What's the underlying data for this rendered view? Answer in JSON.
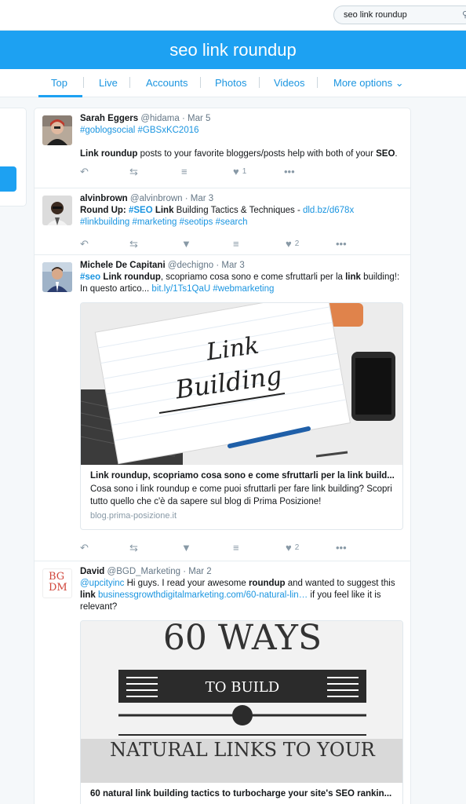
{
  "search": {
    "query": "seo link roundup",
    "icon": "search-icon"
  },
  "header": {
    "title": "seo link roundup"
  },
  "tabs": [
    {
      "label": "Top"
    },
    {
      "label": "Live"
    },
    {
      "label": "Accounts"
    },
    {
      "label": "Photos"
    },
    {
      "label": "Videos"
    },
    {
      "label": "More options ⌄"
    }
  ],
  "tweets": [
    {
      "name": "Sarah Eggers",
      "handle": "@hidama",
      "date": "· Mar 5",
      "hashtags": "#goblogsocial #GBSxKC2016",
      "text_b1": "Link roundup",
      "text_1": " posts to your favorite bloggers/posts help with both of your ",
      "text_b2": "SEO",
      "text_2": ".",
      "like_count": "1"
    },
    {
      "name": "alvinbrown",
      "handle": "@alvinbrown",
      "date": "· Mar 3",
      "text_1": "Round Up: ",
      "text_h1": "#SEO",
      "text_b1": " Link",
      "text_2": " Building Tactics & Techniques - ",
      "link": "dld.bz/d678x",
      "hashtags": "#linkbuilding #marketing #seotips #search",
      "like_count": "2"
    },
    {
      "name": "Michele De Capitani",
      "handle": "@dechigno",
      "date": "· Mar 3",
      "text_h1": "#seo",
      "text_b1": " Link roundup",
      "text_1": ", scopriamo cosa sono e come sfruttarli per la ",
      "text_b2": "link",
      "text_2": " building!:",
      "text_3": "In questo artico... ",
      "link": "bit.ly/1Ts1QaU",
      "hashtag": " #webmarketing",
      "card_title": "Link roundup, scopriamo cosa sono e come sfruttarli per la link build...",
      "card_desc": "Cosa sono i link roundup e come puoi sfruttarli per fare link building? Scopri tutto quello che c'è da sapere sul blog di Prima Posizione!",
      "card_domain": "blog.prima-posizione.it",
      "image_line1": "Link",
      "image_line2": "Building",
      "like_count": "2"
    },
    {
      "name": "David",
      "handle": "@BGD_Marketing",
      "date": "· Mar 2",
      "mention": "@upcityinc",
      "text_1": " Hi guys. I read your awesome ",
      "text_b1": "roundup",
      "text_2": " and wanted to suggest this ",
      "text_b2": "link",
      "text_3": " ",
      "link": "businessgrowthdigitalmarketing.com/60-natural-lin…",
      "text_4": " if you feel like it is relevant?",
      "avatar_text_1": "BG",
      "avatar_text_2": "DM",
      "image_line1": "60 WAYS",
      "image_line2": "TO BUILD",
      "image_line3": "NATURAL LINKS TO YOUR",
      "card_title": "60 natural link building tactics to turbocharge your site's SEO rankin..."
    }
  ],
  "colors": {
    "brand": "#1da1f2",
    "link": "#1b95e0",
    "muted": "#8899a6"
  }
}
